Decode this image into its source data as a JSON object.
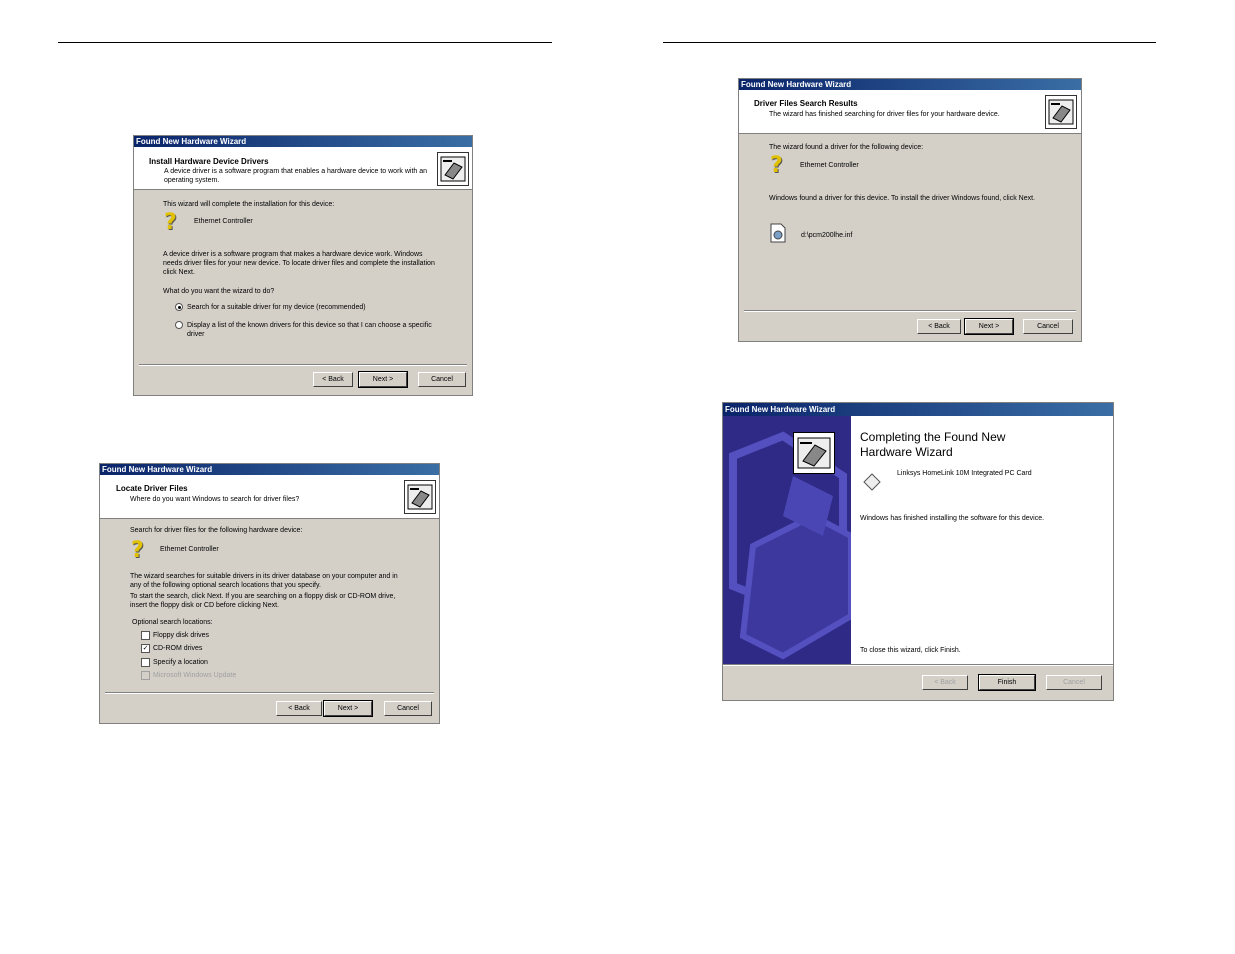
{
  "wizard1": {
    "title": "Found New Hardware Wizard",
    "header_title": "Install Hardware Device Drivers",
    "header_sub": "A device driver is a software program that enables a hardware device to work with an operating system.",
    "intro": "This wizard will complete the installation for this device:",
    "device": "Ethernet Controller",
    "para": "A device driver is a software program that makes a hardware device work. Windows needs driver files for your new device. To locate driver files and complete the installation click Next.",
    "question": "What do you want the wizard to do?",
    "option1": "Search for a suitable driver for my device (recommended)",
    "option2": "Display a list of the known drivers for this device so that I can choose a specific driver",
    "back": "< Back",
    "next": "Next >",
    "cancel": "Cancel"
  },
  "wizard2": {
    "title": "Found New Hardware Wizard",
    "header_title": "Locate Driver Files",
    "header_sub": "Where do you want Windows to search for driver files?",
    "intro": "Search for driver files for the following hardware device:",
    "device": "Ethernet Controller",
    "para1": "The wizard searches for suitable drivers in its driver database on your computer and in any of the following optional search locations that you specify.",
    "para2": "To start the search, click Next. If you are searching on a floppy disk or CD-ROM drive, insert the floppy disk or CD before clicking Next.",
    "optional_label": "Optional search locations:",
    "options": [
      "Floppy disk drives",
      "CD-ROM drives",
      "Specify a location",
      "Microsoft Windows Update"
    ],
    "back": "< Back",
    "next": "Next >",
    "cancel": "Cancel"
  },
  "wizard3": {
    "title": "Found New Hardware Wizard",
    "header_title": "Driver Files Search Results",
    "header_sub": "The wizard has finished searching for driver files for your hardware device.",
    "intro": "The wizard found a driver for the following device:",
    "device": "Ethernet Controller",
    "found": "Windows found a driver for this device. To install the driver Windows found, click Next.",
    "file": "d:\\pcm200lhe.inf",
    "back": "< Back",
    "next": "Next >",
    "cancel": "Cancel"
  },
  "wizard4": {
    "title": "Found New Hardware Wizard",
    "heading": "Completing the Found New Hardware Wizard",
    "device": "Linksys HomeLink 10M Integrated PC Card",
    "finished": "Windows has finished installing the software for this device.",
    "close": "To close this wizard, click Finish.",
    "back": "< Back",
    "finish": "Finish",
    "cancel": "Cancel"
  }
}
